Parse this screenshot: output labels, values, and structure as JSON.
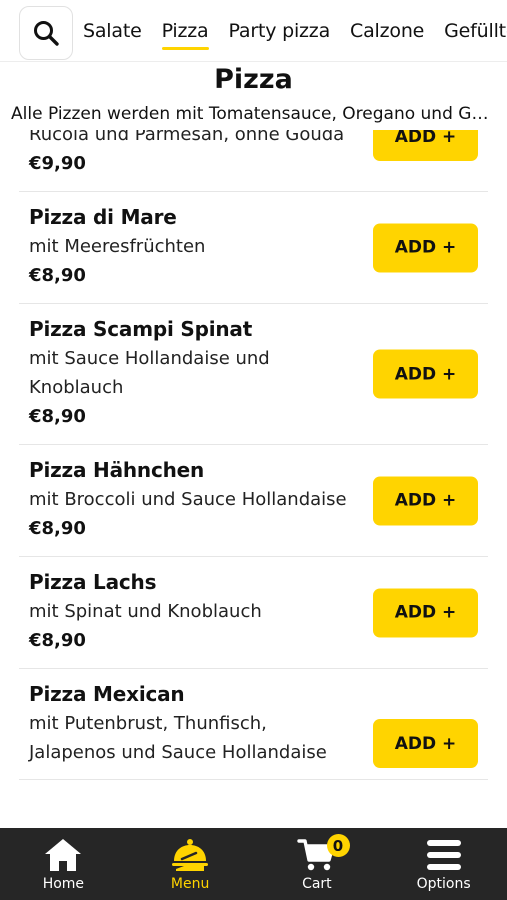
{
  "categories": [
    "Salate",
    "Pizza",
    "Party pizza",
    "Calzone",
    "Gefüllte"
  ],
  "active_category": "Pizza",
  "section": {
    "title": "Pizza",
    "subtitle": "Alle Pizzen werden mit Tomatensauce, Oregano und Gouda gebacken"
  },
  "items": [
    {
      "name": "",
      "desc": "Rucola und Parmesan, ohne Gouda",
      "price": "€9,90",
      "add_label": "ADD +"
    },
    {
      "name": "Pizza di Mare",
      "desc": "mit Meeresfrüchten",
      "price": "€8,90",
      "add_label": "ADD +"
    },
    {
      "name": "Pizza Scampi Spinat",
      "desc": "mit Sauce Hollandaise und Knoblauch",
      "price": "€8,90",
      "add_label": "ADD +"
    },
    {
      "name": "Pizza Hähnchen",
      "desc": "mit Broccoli und Sauce Hollandaise",
      "price": "€8,90",
      "add_label": "ADD +"
    },
    {
      "name": "Pizza Lachs",
      "desc": "mit Spinat und Knoblauch",
      "price": "€8,90",
      "add_label": "ADD +"
    },
    {
      "name": "Pizza Mexican",
      "desc": "mit Putenbrust, Thunfisch, Jalapenos und Sauce Hollandaise",
      "price": "",
      "add_label": "ADD +"
    }
  ],
  "nav": {
    "home": "Home",
    "menu": "Menu",
    "cart": "Cart",
    "options": "Options",
    "cart_count": "0"
  },
  "icons": {
    "search": "search-icon",
    "home": "home-icon",
    "menu": "serving-dish-icon",
    "cart": "cart-icon",
    "options": "hamburger-menu-icon"
  },
  "colors": {
    "accent": "#ffd400",
    "nav_background": "#262626",
    "text": "#111111"
  }
}
